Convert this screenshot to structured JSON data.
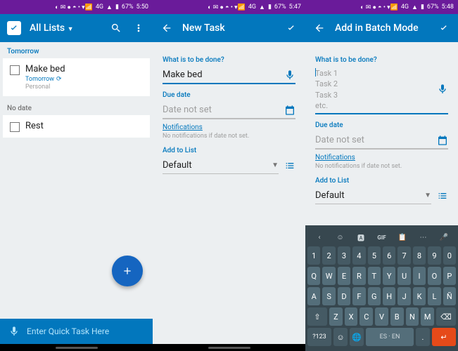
{
  "status": {
    "battery": "67%",
    "times": [
      "5:50",
      "5:47",
      "5:48"
    ],
    "net": "4G"
  },
  "screen1": {
    "title": "All Lists",
    "sections": [
      {
        "header": "Tomorrow",
        "color": "blue",
        "tasks": [
          {
            "title": "Make bed",
            "sub": "Tomorrow",
            "sub2": "Personal"
          }
        ]
      },
      {
        "header": "No date",
        "color": "gray",
        "tasks": [
          {
            "title": "Rest"
          }
        ]
      }
    ],
    "quick_placeholder": "Enter Quick Task Here"
  },
  "screen2": {
    "title": "New Task",
    "q_label": "What is to be done?",
    "q_value": "Make bed",
    "due_label": "Due date",
    "due_placeholder": "Date not set",
    "notif_link": "Notifications",
    "notif_hint": "No notifications if date not set.",
    "list_label": "Add to List",
    "list_value": "Default"
  },
  "screen3": {
    "title": "Add in Batch Mode",
    "q_label": "What is to be done?",
    "batch_hint": [
      "Task 1",
      "Task 2",
      "Task 3",
      "etc."
    ],
    "due_label": "Due date",
    "due_placeholder": "Date not set",
    "notif_link": "Notifications",
    "notif_hint": "No notifications if date not set.",
    "list_label": "Add to List",
    "list_value": "Default"
  },
  "keyboard": {
    "row0": [
      "1",
      "2",
      "3",
      "4",
      "5",
      "6",
      "7",
      "8",
      "9",
      "0"
    ],
    "row1": [
      "Q",
      "W",
      "E",
      "R",
      "T",
      "Y",
      "U",
      "I",
      "O",
      "P"
    ],
    "row2": [
      "A",
      "S",
      "D",
      "F",
      "G",
      "H",
      "J",
      "K",
      "L",
      "Ñ"
    ],
    "row3": [
      "Z",
      "X",
      "C",
      "V",
      "B",
      "N",
      "M"
    ],
    "sym": "?123",
    "lang": "ES · EN"
  }
}
